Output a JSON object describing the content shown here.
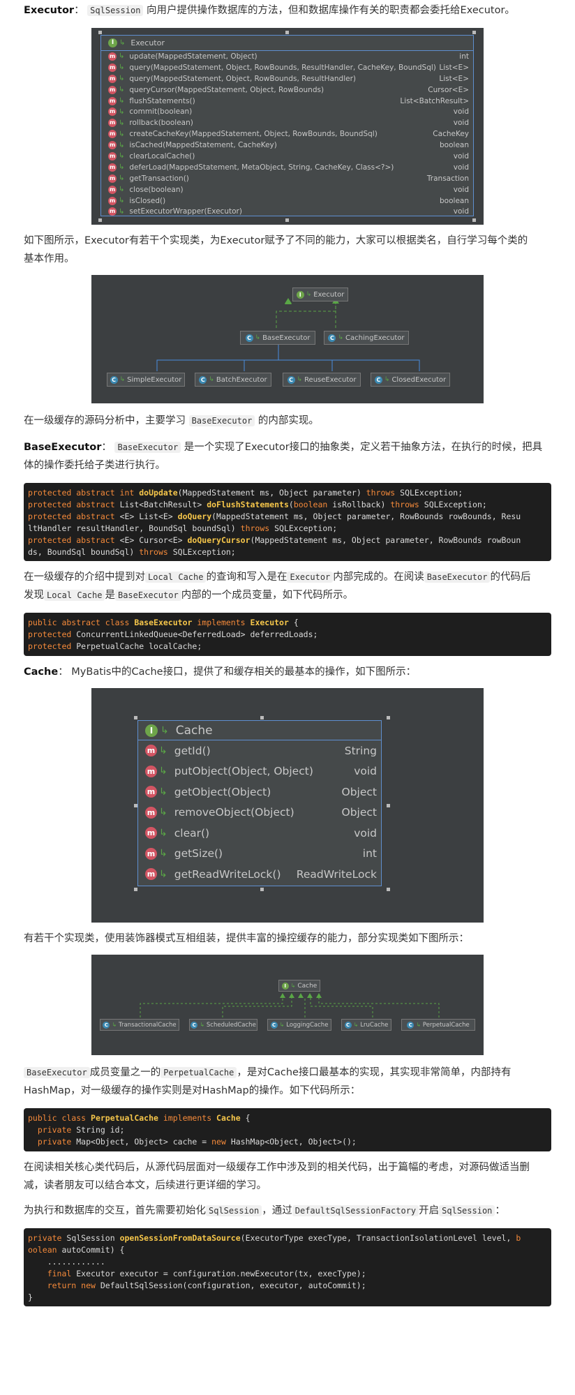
{
  "p1": {
    "title": "Executor",
    "sep": "：",
    "code": "SqlSession",
    "text": "向用户提供操作数据库的方法，但和数据库操作有关的职责都会委托给Executor。"
  },
  "executor_uml": {
    "name": "Executor",
    "methods": [
      {
        "name": "update(MappedStatement, Object)",
        "ret": "int"
      },
      {
        "name": "query(MappedStatement, Object, RowBounds, ResultHandler, CacheKey, BoundSql)",
        "ret": "List<E>"
      },
      {
        "name": "query(MappedStatement, Object, RowBounds, ResultHandler)",
        "ret": "List<E>"
      },
      {
        "name": "queryCursor(MappedStatement, Object, RowBounds)",
        "ret": "Cursor<E>"
      },
      {
        "name": "flushStatements()",
        "ret": "List<BatchResult>"
      },
      {
        "name": "commit(boolean)",
        "ret": "void"
      },
      {
        "name": "rollback(boolean)",
        "ret": "void"
      },
      {
        "name": "createCacheKey(MappedStatement, Object, RowBounds, BoundSql)",
        "ret": "CacheKey"
      },
      {
        "name": "isCached(MappedStatement, CacheKey)",
        "ret": "boolean"
      },
      {
        "name": "clearLocalCache()",
        "ret": "void"
      },
      {
        "name": "deferLoad(MappedStatement, MetaObject, String, CacheKey, Class<?>)",
        "ret": "void"
      },
      {
        "name": "getTransaction()",
        "ret": "Transaction"
      },
      {
        "name": "close(boolean)",
        "ret": "void"
      },
      {
        "name": "isClosed()",
        "ret": "boolean"
      },
      {
        "name": "setExecutorWrapper(Executor)",
        "ret": "void"
      }
    ]
  },
  "p2": {
    "line1": "如下图所示，Executor有若干个实现类，为Executor赋予了不同的能力，大家可以根据类名，自行学习每个类的",
    "line2": "基本作用。"
  },
  "executor_diagram": {
    "root": "Executor",
    "mid": [
      "BaseExecutor",
      "CachingExecutor"
    ],
    "leaves": [
      "SimpleExecutor",
      "BatchExecutor",
      "ReuseExecutor",
      "ClosedExecutor"
    ]
  },
  "p3": {
    "pre": "在一级缓存的源码分析中，主要学习",
    "code": "BaseExecutor",
    "post": "的内部实现。"
  },
  "p4": {
    "title": "BaseExecutor",
    "sep": "：",
    "code": "BaseExecutor",
    "line1": "是一个实现了Executor接口的抽象类，定义若干抽象方法，在执行的时候，把具",
    "line2": "体的操作委托给子类进行执行。"
  },
  "code1": {
    "l1": {
      "a": "protected abstract int ",
      "b": "doUpdate",
      "c": "(MappedStatement ms, Object parameter) ",
      "d": "throws",
      "e": " SQLException;"
    },
    "l2": {
      "a": "protected abstract ",
      "x": "List<BatchResult> ",
      "b": "doFlushStatements",
      "c": "(",
      "k2": "boolean",
      "c2": " isRollback) ",
      "d": "throws",
      "e": " SQLException;"
    },
    "l3": {
      "a": "protected abstract ",
      "x": "<E> List<E> ",
      "b": "doQuery",
      "c": "(MappedStatement ms, Object parameter, RowBounds rowBounds, Resu"
    },
    "l4": {
      "c": "ltHandler resultHandler, BoundSql boundSql) ",
      "d": "throws",
      "e": " SQLException;"
    },
    "l5": {
      "a": "protected abstract ",
      "x": "<E> Cursor<E> ",
      "b": "doQueryCursor",
      "c": "(MappedStatement ms, Object parameter, RowBounds rowBoun"
    },
    "l6": {
      "c": "ds, BoundSql boundSql) ",
      "d": "throws",
      "e": " SQLException;"
    }
  },
  "p5": {
    "a": "在一级缓存的介绍中提到对",
    "c1": "Local Cache",
    "b": "的查询和写入是在",
    "c2": "Executor",
    "c": "内部完成的。在阅读",
    "c3": "BaseExecutor",
    "d": "的代码后",
    "e": "发现",
    "c4": "Local Cache",
    "f": "是",
    "c5": "BaseExecutor",
    "g": "内部的一个成员变量，如下代码所示。"
  },
  "code2": {
    "l1": {
      "a": "public abstract class ",
      "b": "BaseExecutor",
      "c": " implements ",
      "d": "Executor",
      "e": " {"
    },
    "l2": {
      "a": "protected ",
      "e": "ConcurrentLinkedQueue<DeferredLoad> deferredLoads;"
    },
    "l3": {
      "a": "protected ",
      "e": "PerpetualCache localCache;"
    }
  },
  "p6": {
    "title": "Cache",
    "sep": "：",
    "text": "MyBatis中的Cache接口，提供了和缓存相关的最基本的操作，如下图所示："
  },
  "cache_uml": {
    "name": "Cache",
    "methods": [
      {
        "name": "getId()",
        "ret": "String"
      },
      {
        "name": "putObject(Object, Object)",
        "ret": "void"
      },
      {
        "name": "getObject(Object)",
        "ret": "Object"
      },
      {
        "name": "removeObject(Object)",
        "ret": "Object"
      },
      {
        "name": "clear()",
        "ret": "void"
      },
      {
        "name": "getSize()",
        "ret": "int"
      },
      {
        "name": "getReadWriteLock()",
        "ret": "ReadWriteLock"
      }
    ]
  },
  "p7": {
    "text": "有若干个实现类，使用装饰器模式互相组装，提供丰富的操控缓存的能力，部分实现类如下图所示："
  },
  "cache_diagram": {
    "root": "Cache",
    "leaves": [
      "TransactionalCache",
      "ScheduledCache",
      "LoggingCache",
      "LruCache",
      "PerpetualCache"
    ]
  },
  "p8": {
    "c1": "BaseExecutor",
    "a": "成员变量之一的",
    "c2": "PerpetualCache",
    "b": "，是对Cache接口最基本的实现，其实现非常简单，内部持有",
    "line2": "HashMap，对一级缓存的操作实则是对HashMap的操作。如下代码所示："
  },
  "code3": {
    "l1": {
      "a": "public class ",
      "b": "PerpetualCache",
      "c": " implements ",
      "d": "Cache",
      "e": " {"
    },
    "l2": {
      "a": "  private ",
      "e": "String id;"
    },
    "l3": {
      "a": "  private ",
      "e": "Map<Object, Object> cache = ",
      "k": "new",
      "f": " HashMap<Object, Object>();"
    }
  },
  "p9": {
    "line1": "在阅读相关核心类代码后，从源代码层面对一级缓存工作中涉及到的相关代码，出于篇幅的考虑，对源码做适当删",
    "line2": "减，读者朋友可以结合本文，后续进行更详细的学习。"
  },
  "p10": {
    "a": "为执行和数据库的交互，首先需要初始化",
    "c1": "SqlSession",
    "b": "，通过",
    "c2": "DefaultSqlSessionFactory",
    "c": "开启",
    "c3": "SqlSession",
    "d": "："
  },
  "code4": {
    "l1": {
      "a": "private ",
      "x": "SqlSession ",
      "b": "openSessionFromDataSource",
      "c": "(ExecutorType execType, TransactionIsolationLevel level, ",
      "k": "b"
    },
    "l2": {
      "k": "oolean",
      "c": " autoCommit) {"
    },
    "l3": {
      "c": "    ............"
    },
    "l4": {
      "k": "    final",
      "c": " Executor executor = configuration.newExecutor(tx, execType);"
    },
    "l5": {
      "k": "    return new",
      "c": " DefaultSqlSession(configuration, executor, autoCommit);"
    },
    "l6": {
      "c": "}"
    }
  }
}
